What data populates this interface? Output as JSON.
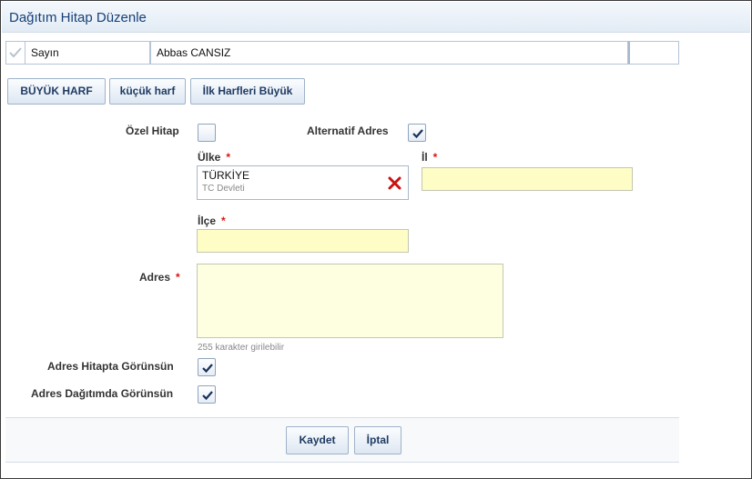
{
  "window": {
    "title": "Dağıtım Hitap Düzenle"
  },
  "hitap": {
    "salutation": "Sayın",
    "name": "Abbas CANSIZ",
    "suffix": ""
  },
  "case_buttons": {
    "upper": "BÜYÜK HARF",
    "lower": "küçük harf",
    "title": "İlk Harfleri Büyük"
  },
  "form": {
    "ozel_hitap": {
      "label": "Özel Hitap",
      "checked": false
    },
    "alternatif_adres": {
      "label": "Alternatif Adres",
      "checked": true
    },
    "ulke": {
      "label": "Ülke",
      "required_mark": "*",
      "value": "TÜRKİYE",
      "sub": "TC Devleti"
    },
    "il": {
      "label": "İl",
      "required_mark": "*",
      "value": ""
    },
    "ilce": {
      "label": "İlçe",
      "required_mark": "*",
      "value": ""
    },
    "adres": {
      "label": "Adres",
      "required_mark": "*",
      "value": "",
      "hint": "255 karakter girilebilir"
    },
    "adres_hitapta": {
      "label": "Adres Hitapta Görünsün",
      "checked": true
    },
    "adres_dagitimda": {
      "label": "Adres Dağıtımda Görünsün",
      "checked": true
    }
  },
  "footer": {
    "save": "Kaydet",
    "cancel": "İptal"
  },
  "colors": {
    "title": "#15417a",
    "required": "#dd1111",
    "input_required_bg": "#fefdc6",
    "remove_icon": "#cc1111"
  },
  "icons": {
    "remove": "x-icon",
    "check": "checkmark-icon"
  }
}
